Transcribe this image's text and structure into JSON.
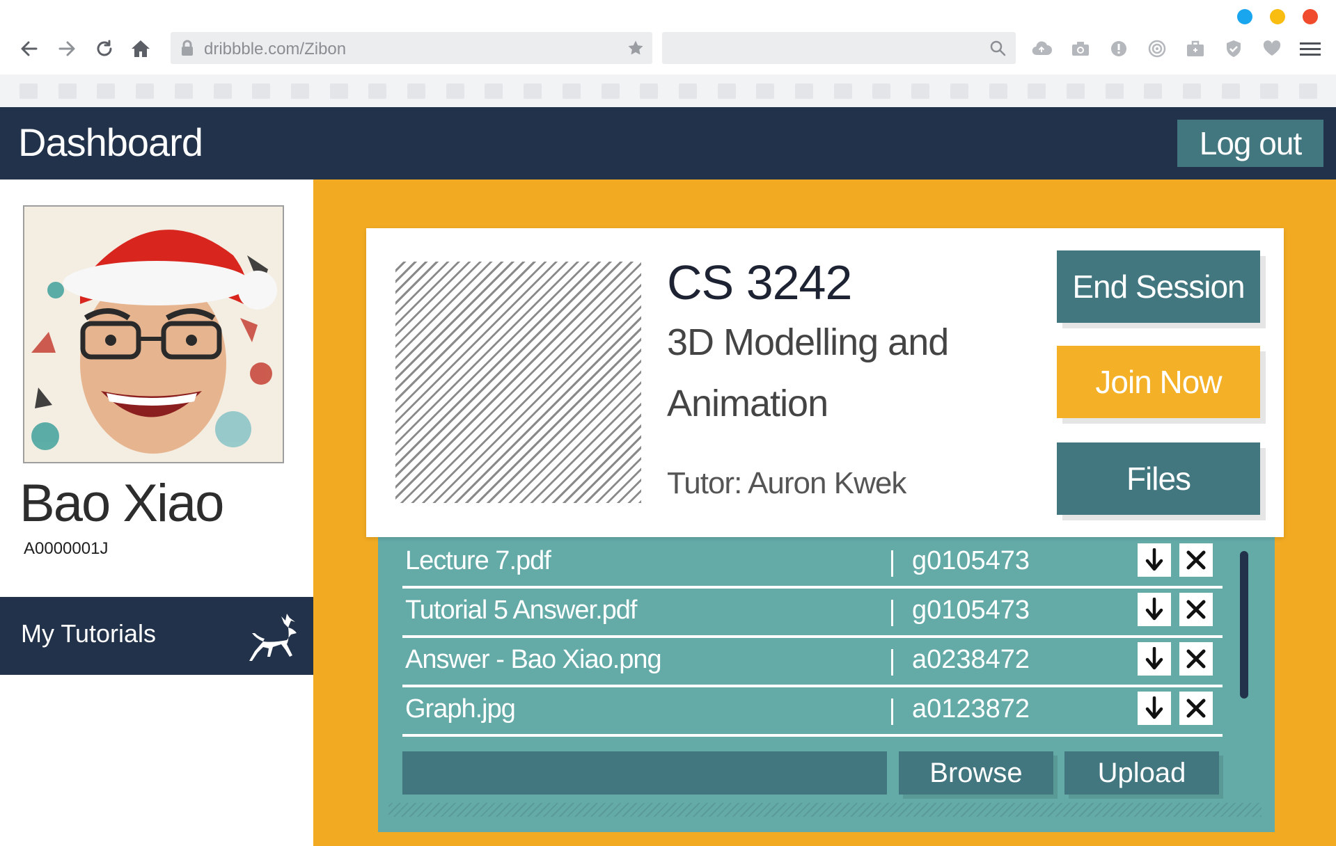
{
  "browser": {
    "url": "dribbble.com/Zibon",
    "search_placeholder": "",
    "window_dot_colors": [
      "#1aa6ef",
      "#f9bd11",
      "#ef4b2c"
    ],
    "toolbar_icons": [
      "cloud-upload-icon",
      "camera-icon",
      "alert-icon",
      "broadcast-icon",
      "briefcase-icon",
      "shield-check-icon",
      "heart-icon",
      "menu-icon"
    ]
  },
  "header": {
    "title": "Dashboard",
    "logout_label": "Log out"
  },
  "profile": {
    "name": "Bao Xiao",
    "id": "A0000001J"
  },
  "sidebar": {
    "items": [
      {
        "label": "My Tutorials",
        "icon": "reindeer-icon"
      }
    ]
  },
  "course": {
    "code": "CS 3242",
    "name": "3D Modelling and Animation",
    "tutor": "Tutor: Auron Kwek",
    "actions": {
      "end_session": "End Session",
      "join_now": "Join Now",
      "files": "Files"
    }
  },
  "files": {
    "rows": [
      {
        "name": "Lecture 7.pdf",
        "owner": "g0105473"
      },
      {
        "name": "Tutorial 5 Answer.pdf",
        "owner": "g0105473"
      },
      {
        "name": "Answer - Bao Xiao.png",
        "owner": "a0238472"
      },
      {
        "name": "Graph.jpg",
        "owner": "a0123872"
      }
    ],
    "path_value": "",
    "browse_label": "Browse",
    "upload_label": "Upload"
  },
  "colors": {
    "navy": "#22324a",
    "teal_dark": "#437780",
    "teal_panel": "#64aba8",
    "orange": "#f1aa22",
    "join_yellow": "#f4b026"
  }
}
